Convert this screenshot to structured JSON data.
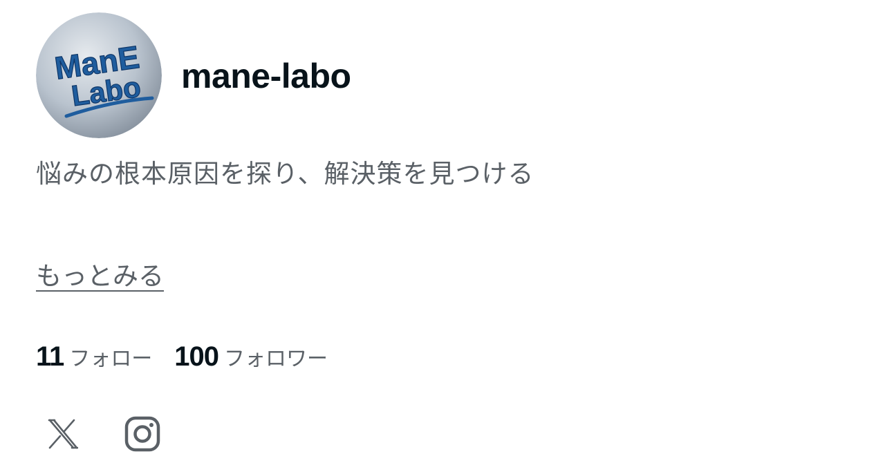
{
  "profile": {
    "username": "mane-labo",
    "avatar_icon": "mane-labo-logo",
    "avatar_logo_line1": "ManE",
    "avatar_logo_line2": "Labo",
    "bio": "悩みの根本原因を探り、解決策を見つける",
    "more_link": "もっとみる"
  },
  "stats": {
    "following_count": "11",
    "following_label": "フォロー",
    "followers_count": "100",
    "followers_label": "フォロワー"
  },
  "social": {
    "items": [
      {
        "icon": "x-icon"
      },
      {
        "icon": "instagram-icon"
      }
    ]
  },
  "colors": {
    "text_primary": "#08131a",
    "text_secondary": "#5a6066",
    "logo_blue": "#1f5d9e",
    "avatar_bg": "#b9c3ce"
  }
}
